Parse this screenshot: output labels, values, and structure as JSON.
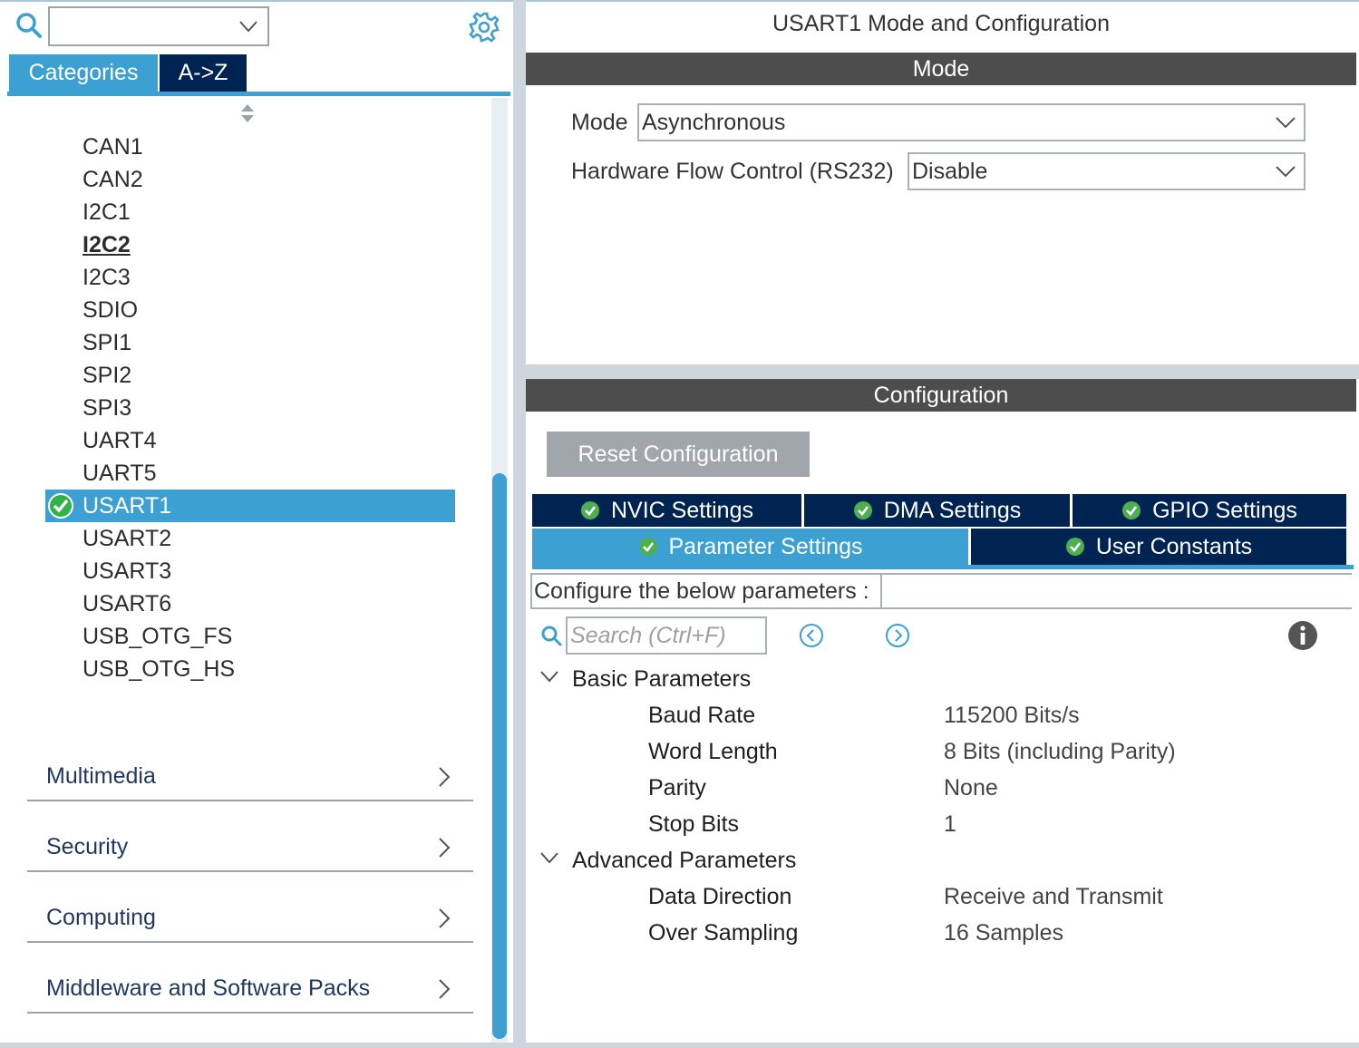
{
  "left_panel": {
    "search_value": "",
    "tabs": {
      "categories": "Categories",
      "az": "A->Z"
    },
    "peripherals": [
      {
        "label": "CAN1",
        "state": "normal"
      },
      {
        "label": "CAN2",
        "state": "normal"
      },
      {
        "label": "I2C1",
        "state": "normal"
      },
      {
        "label": "I2C2",
        "state": "underlined"
      },
      {
        "label": "I2C3",
        "state": "normal"
      },
      {
        "label": "SDIO",
        "state": "normal"
      },
      {
        "label": "SPI1",
        "state": "normal"
      },
      {
        "label": "SPI2",
        "state": "normal"
      },
      {
        "label": "SPI3",
        "state": "normal"
      },
      {
        "label": "UART4",
        "state": "normal"
      },
      {
        "label": "UART5",
        "state": "normal"
      },
      {
        "label": "USART1",
        "state": "selected"
      },
      {
        "label": "USART2",
        "state": "normal"
      },
      {
        "label": "USART3",
        "state": "normal"
      },
      {
        "label": "USART6",
        "state": "normal"
      },
      {
        "label": "USB_OTG_FS",
        "state": "normal"
      },
      {
        "label": "USB_OTG_HS",
        "state": "normal"
      }
    ],
    "categories": [
      {
        "label": "Multimedia"
      },
      {
        "label": "Security"
      },
      {
        "label": "Computing"
      },
      {
        "label": "Middleware and Software Packs"
      }
    ]
  },
  "right_panel": {
    "title": "USART1 Mode and Configuration",
    "mode_header": "Mode",
    "mode_label": "Mode",
    "mode_value": "Asynchronous",
    "hwflow_label": "Hardware Flow Control (RS232)",
    "hwflow_value": "Disable",
    "config_header": "Configuration",
    "reset_button": "Reset Configuration",
    "tabs": {
      "nvic": "NVIC Settings",
      "dma": "DMA Settings",
      "gpio": "GPIO Settings",
      "param": "Parameter Settings",
      "user": "User Constants"
    },
    "configure_label": "Configure the below parameters :",
    "search_placeholder": "Search (Ctrl+F)",
    "basic_group": "Basic Parameters",
    "basic_params": [
      {
        "name": "Baud Rate",
        "value": "115200 Bits/s"
      },
      {
        "name": "Word Length",
        "value": "8 Bits (including Parity)"
      },
      {
        "name": "Parity",
        "value": "None"
      },
      {
        "name": "Stop Bits",
        "value": "1"
      }
    ],
    "advanced_group": "Advanced Parameters",
    "advanced_params": [
      {
        "name": "Data Direction",
        "value": "Receive and Transmit"
      },
      {
        "name": "Over Sampling",
        "value": "16 Samples"
      }
    ]
  },
  "colors": {
    "accent_blue": "#3ca0d2",
    "dark_navy": "#002452",
    "header_gray": "#4d4d4d",
    "check_green": "#34b24a"
  }
}
